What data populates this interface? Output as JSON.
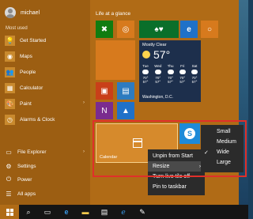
{
  "user": {
    "name": "michael"
  },
  "left": {
    "most_used_label": "Most used",
    "apps": [
      {
        "label": "Get Started",
        "icon": "lightbulb-icon",
        "glyph": "💡"
      },
      {
        "label": "Maps",
        "icon": "maps-icon",
        "glyph": "◉"
      },
      {
        "label": "People",
        "icon": "people-icon",
        "glyph": "👥"
      },
      {
        "label": "Calculator",
        "icon": "calculator-icon",
        "glyph": "▦"
      },
      {
        "label": "Paint",
        "icon": "paint-icon",
        "glyph": "🎨"
      },
      {
        "label": "Alarms & Clock",
        "icon": "clock-icon",
        "glyph": "◷"
      }
    ],
    "bottom": [
      {
        "label": "File Explorer",
        "icon": "folder-icon",
        "glyph": "▭"
      },
      {
        "label": "Settings",
        "icon": "gear-icon",
        "glyph": "⚙"
      },
      {
        "label": "Power",
        "icon": "power-icon",
        "glyph": "⏻"
      },
      {
        "label": "All apps",
        "icon": "all-apps-icon",
        "glyph": "☰"
      }
    ]
  },
  "tiles": {
    "group_title": "Life at a glance",
    "weather": {
      "condition": "Mostly Clear",
      "temp": "57°",
      "days": [
        {
          "name": "Tue",
          "hi": "70°",
          "lo": "57°"
        },
        {
          "name": "Wed",
          "hi": "70°",
          "lo": "57°"
        },
        {
          "name": "Thu",
          "hi": "70°",
          "lo": "57°"
        },
        {
          "name": "Fri",
          "hi": "70°",
          "lo": "57°"
        },
        {
          "name": "Sat",
          "hi": "70°",
          "lo": "57°"
        }
      ],
      "location": "Washington, D.C."
    },
    "calendar_label": "Calendar"
  },
  "context_menu": {
    "items": [
      "Unpin from Start",
      "Resize",
      "Turn live tile off",
      "Pin to taskbar"
    ],
    "resize_arrow": "›"
  },
  "resize_menu": {
    "items": [
      "Small",
      "Medium",
      "Wide",
      "Large"
    ],
    "checked": "Wide",
    "check_glyph": "✓"
  },
  "colors": {
    "accent": "#b06b16",
    "highlight": "#e0302a"
  }
}
